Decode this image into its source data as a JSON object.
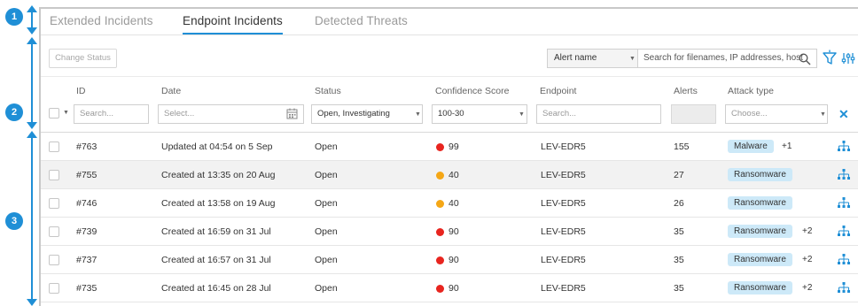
{
  "annotations": [
    "1",
    "2",
    "3"
  ],
  "tabs": [
    {
      "label": "Extended Incidents",
      "active": false
    },
    {
      "label": "Endpoint Incidents",
      "active": true
    },
    {
      "label": "Detected Threats",
      "active": false
    }
  ],
  "toolbar": {
    "change_status_label": "Change Status",
    "alert_select_value": "Alert name",
    "search_placeholder": "Search for filenames, IP addresses, host"
  },
  "columns": [
    "ID",
    "Date",
    "Status",
    "Confidence Score",
    "Endpoint",
    "Alerts",
    "Attack type"
  ],
  "filters": {
    "id_placeholder": "Search...",
    "date_placeholder": "Select...",
    "status_value": "Open, Investigating",
    "confidence_value": "100-30",
    "endpoint_placeholder": "Search...",
    "attack_placeholder": "Choose..."
  },
  "colors": {
    "accent": "#1f8fd6",
    "red": "#e8251f",
    "orange": "#f5a716",
    "tag_bg": "#cde9f8"
  },
  "rows": [
    {
      "id": "#763",
      "date": "Updated at 04:54 on 5 Sep",
      "status": "Open",
      "score": "99",
      "score_color": "red",
      "endpoint": "LEV-EDR5",
      "alerts": "155",
      "attack": "Malware",
      "extra": "+1"
    },
    {
      "id": "#755",
      "date": "Created at 13:35 on 20 Aug",
      "status": "Open",
      "score": "40",
      "score_color": "orange",
      "endpoint": "LEV-EDR5",
      "alerts": "27",
      "attack": "Ransomware",
      "extra": ""
    },
    {
      "id": "#746",
      "date": "Created at 13:58 on 19 Aug",
      "status": "Open",
      "score": "40",
      "score_color": "orange",
      "endpoint": "LEV-EDR5",
      "alerts": "26",
      "attack": "Ransomware",
      "extra": ""
    },
    {
      "id": "#739",
      "date": "Created at 16:59 on 31 Jul",
      "status": "Open",
      "score": "90",
      "score_color": "red",
      "endpoint": "LEV-EDR5",
      "alerts": "35",
      "attack": "Ransomware",
      "extra": "+2"
    },
    {
      "id": "#737",
      "date": "Created at 16:57 on 31 Jul",
      "status": "Open",
      "score": "90",
      "score_color": "red",
      "endpoint": "LEV-EDR5",
      "alerts": "35",
      "attack": "Ransomware",
      "extra": "+2"
    },
    {
      "id": "#735",
      "date": "Created at 16:45 on 28 Jul",
      "status": "Open",
      "score": "90",
      "score_color": "red",
      "endpoint": "LEV-EDR5",
      "alerts": "35",
      "attack": "Ransomware",
      "extra": "+2"
    }
  ]
}
